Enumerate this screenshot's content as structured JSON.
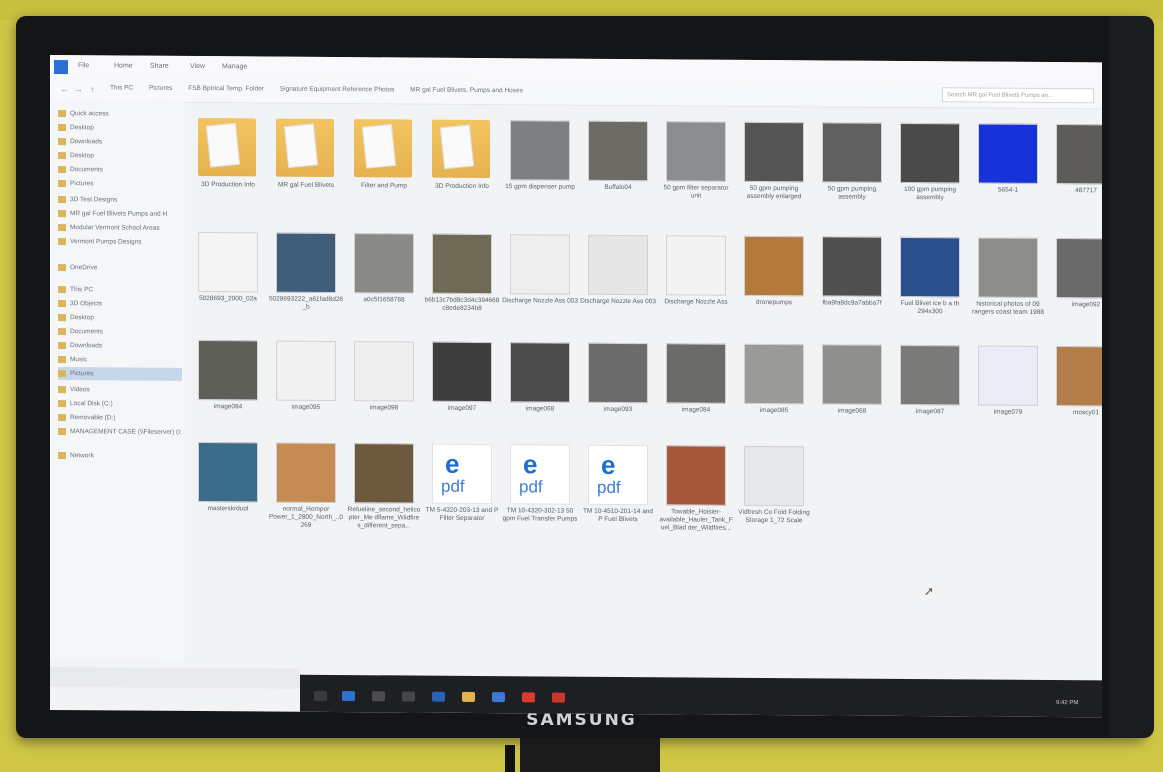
{
  "monitor": {
    "brand": "SAMSUNG"
  },
  "ribbon": {
    "tabs": [
      "File",
      "Home",
      "Share",
      "View",
      "Manage"
    ]
  },
  "address": {
    "back": "←",
    "forward": "→",
    "up": "↑",
    "crumbs": [
      "This PC",
      "Pictures",
      "FSB Bptrical Temp. Folder",
      "Signature Equipment Reference Photos",
      "MR gal Fuel Blivets, Pumps and Hoses"
    ],
    "search_placeholder": "Search MR gal Fuel Blivets Pumps an..."
  },
  "nav": {
    "items": [
      {
        "label": "Quick access",
        "selected": false
      },
      {
        "label": "Desktop",
        "selected": false
      },
      {
        "label": "Downloads",
        "selected": false
      },
      {
        "label": "Desktop",
        "selected": false
      },
      {
        "label": "Documents",
        "selected": false
      },
      {
        "label": "Pictures",
        "selected": false
      },
      {
        "label": "3D Test Designs",
        "selected": false
      },
      {
        "label": "MR gal Fuel Blivets Pumps and H",
        "selected": false
      },
      {
        "label": "Modular Vermont School Areas",
        "selected": false
      },
      {
        "label": "Vermont Pumps Designs",
        "selected": false
      },
      {
        "label": "OneDrive",
        "selected": false
      },
      {
        "label": "This PC",
        "selected": false
      },
      {
        "label": "3D Objects",
        "selected": false
      },
      {
        "label": "Desktop",
        "selected": false
      },
      {
        "label": "Documents",
        "selected": false
      },
      {
        "label": "Downloads",
        "selected": false
      },
      {
        "label": "Music",
        "selected": false
      },
      {
        "label": "Pictures",
        "selected": true
      },
      {
        "label": "Videos",
        "selected": false
      },
      {
        "label": "Local Disk (C:)",
        "selected": false
      },
      {
        "label": "Removable (D:)",
        "selected": false
      },
      {
        "label": "MANAGEMENT CASE (\\\\Fileserver) (I:)",
        "selected": false
      },
      {
        "label": "Network",
        "selected": false
      }
    ]
  },
  "files": [
    {
      "name": "3D Production Info",
      "kind": "folder"
    },
    {
      "name": "MR gal Fuel Blivets",
      "kind": "folder"
    },
    {
      "name": "Filter and Pump",
      "kind": "folder"
    },
    {
      "name": "3D Production Info",
      "kind": "folder"
    },
    {
      "name": "15 gpm dispenser pump",
      "kind": "photo",
      "color": "#7d7f80"
    },
    {
      "name": "Buffalo04",
      "kind": "photo",
      "color": "#6d6b66"
    },
    {
      "name": "50 gpm filter separator unit",
      "kind": "photo",
      "color": "#8b8d90"
    },
    {
      "name": "50 gpm pumping assembly enlarged",
      "kind": "photo",
      "color": "#555"
    },
    {
      "name": "50 gpm pumping assembly",
      "kind": "photo",
      "color": "#606060"
    },
    {
      "name": "100 gpm pumping assembly",
      "kind": "photo",
      "color": "#4a4a4a"
    },
    {
      "name": "5654-1",
      "kind": "photo",
      "color": "#1632d8"
    },
    {
      "name": "487717",
      "kind": "photo",
      "color": "#5d5c58"
    },
    {
      "name": "5028693_2000_02a",
      "kind": "photo",
      "color": "#f4f4f4"
    },
    {
      "name": "5028693222_a61fad8d26_b",
      "kind": "photo",
      "color": "#3f5c78"
    },
    {
      "name": "a0c5f1658788",
      "kind": "photo",
      "color": "#8a8a86"
    },
    {
      "name": "b6b13c7bd8c3d4c394668c8ede8234b8",
      "kind": "photo",
      "color": "#6f6a55"
    },
    {
      "name": "Discharge Nozzle Ass 003",
      "kind": "photo",
      "color": "#eeeeee"
    },
    {
      "name": "Discharge Nozzle Ass 003",
      "kind": "photo",
      "color": "#e6e6e6"
    },
    {
      "name": "Discharge Nozzle Ass",
      "kind": "photo",
      "color": "#f2f2f2"
    },
    {
      "name": "dronepumps",
      "kind": "photo",
      "color": "#b37a3c"
    },
    {
      "name": "fba9fa8dc9a7abba7f",
      "kind": "photo",
      "color": "#505050"
    },
    {
      "name": "Fuel Blivet ice b a th 294x300",
      "kind": "photo",
      "color": "#2a4f8f"
    },
    {
      "name": "historical photos of 09 rangers coast team 1988",
      "kind": "photo",
      "color": "#8d8d8a"
    },
    {
      "name": "image092",
      "kind": "photo",
      "color": "#6a6a6a"
    },
    {
      "name": "image084",
      "kind": "photo",
      "color": "#5f5f5a"
    },
    {
      "name": "image095",
      "kind": "photo",
      "color": "#f1f1f1"
    },
    {
      "name": "image098",
      "kind": "photo",
      "color": "#efefef"
    },
    {
      "name": "image097",
      "kind": "photo",
      "color": "#3d3d3d"
    },
    {
      "name": "image068",
      "kind": "photo",
      "color": "#4b4b4b"
    },
    {
      "name": "image093",
      "kind": "photo",
      "color": "#6c6c6c"
    },
    {
      "name": "image084",
      "kind": "photo",
      "color": "#6b6b69"
    },
    {
      "name": "image085",
      "kind": "photo",
      "color": "#9a9a98"
    },
    {
      "name": "image068",
      "kind": "photo",
      "color": "#8f8f8d"
    },
    {
      "name": "image087",
      "kind": "photo",
      "color": "#7a7a78"
    },
    {
      "name": "image079",
      "kind": "photo",
      "color": "#e9ecf4"
    },
    {
      "name": "moscy01",
      "kind": "photo",
      "color": "#b27d48"
    },
    {
      "name": "masterskrduol",
      "kind": "photo",
      "color": "#3b6c8a"
    },
    {
      "name": "normal_Hompor Power_1_2800_North_..0269",
      "kind": "photo",
      "color": "#c58b52"
    },
    {
      "name": "Refueline_second_helicopter_Me dflame_Wildfire s_different_sepa...",
      "kind": "photo",
      "color": "#6d5a3e"
    },
    {
      "name": "TM 5-4320-203-13 and P Filter Separator",
      "kind": "pdf"
    },
    {
      "name": "TM 10-4320-302-13 50 gpm Fuel Transfer Pumps",
      "kind": "pdf"
    },
    {
      "name": "TM 10-4510-201-14 and P Fuel Blivets",
      "kind": "pdf"
    },
    {
      "name": "Towable_Hoisier-available_Hauler_Tank_Fuel_Blad der_Wildfires...",
      "kind": "photo",
      "color": "#a8583a"
    },
    {
      "name": "Vidfresh Co Fold Folding Storage 1_72 Scale",
      "kind": "photo",
      "color": "#e7e8ec"
    }
  ],
  "taskbar": {
    "time": "9:42 PM"
  }
}
